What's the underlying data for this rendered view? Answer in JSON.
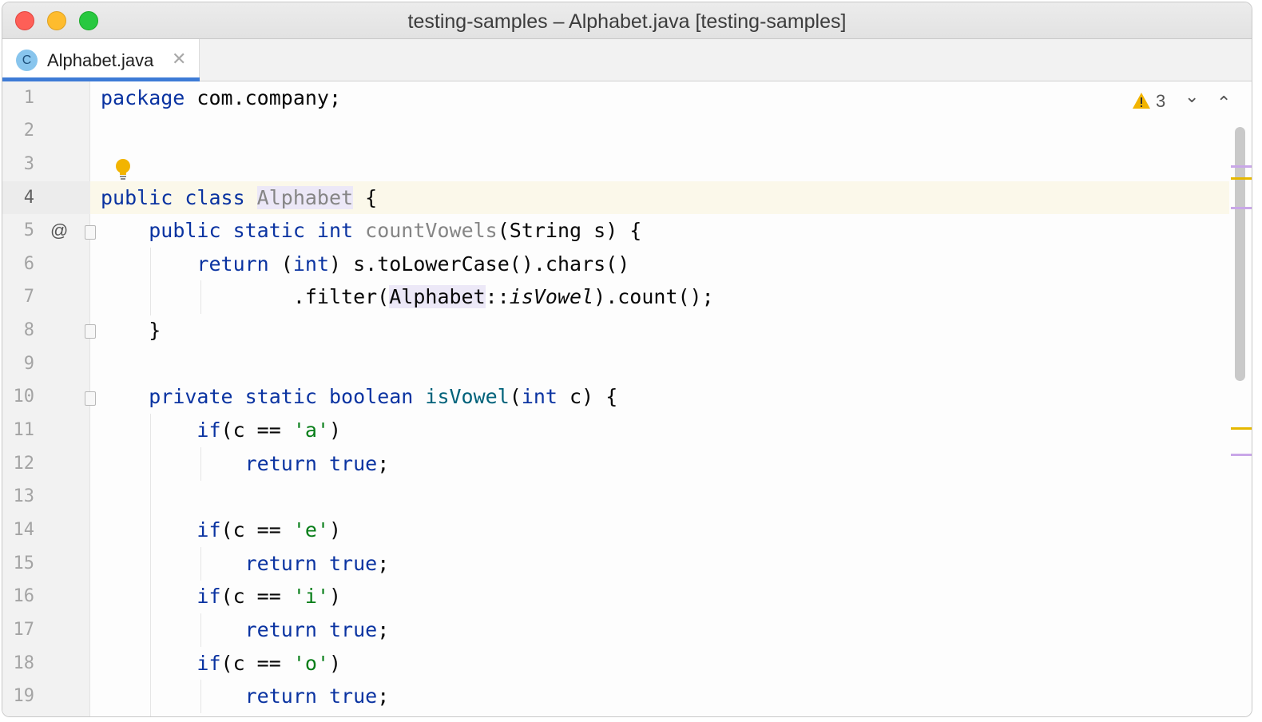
{
  "window": {
    "title": "testing-samples – Alphabet.java [testing-samples]"
  },
  "tab": {
    "label": "Alphabet.java",
    "icon_letter": "C",
    "close_glyph": "✕"
  },
  "inspections": {
    "warning_count": "3",
    "prev_glyph": "⌄",
    "next_glyph": "⌃"
  },
  "gutter": {
    "line_numbers": [
      "1",
      "2",
      "3",
      "4",
      "5",
      "6",
      "7",
      "8",
      "9",
      "10",
      "11",
      "12",
      "13",
      "14",
      "15",
      "16",
      "17",
      "18",
      "19"
    ],
    "override_marker": "@"
  },
  "code": {
    "l1_kw": "package",
    "l1_rest": " com.company;",
    "l4_kw": "public class ",
    "l4_cls": "Alphabet",
    "l4_rest": " {",
    "l5_kw": "public static int ",
    "l5_fn": "countVowels",
    "l5_rest": "(String s) {",
    "l6_kw": "return",
    "l6_p1": " (",
    "l6_int": "int",
    "l6_rest": ") s.toLowerCase().chars()",
    "l7_a": ".filter(",
    "l7_cls": "Alphabet",
    "l7_b": "::",
    "l7_it": "isVowel",
    "l7_c": ").count();",
    "l8": "}",
    "l10_kw": "private static boolean ",
    "l10_fn": "isVowel",
    "l10_p": "(",
    "l10_int": "int",
    "l10_rest": " c) {",
    "if_kw": "if",
    "if_mid": "(c == ",
    "if_close": ")",
    "ret_kw": "return true",
    "semi": ";",
    "chars": [
      "'a'",
      "'e'",
      "'i'",
      "'o'"
    ]
  },
  "colors": {
    "keyword": "#0a33a1",
    "function_decl": "#00627a",
    "string": "#067d17",
    "warning": "#f2b400",
    "stripe_purple": "#c9a7e8",
    "stripe_yellow": "#e6b800"
  }
}
